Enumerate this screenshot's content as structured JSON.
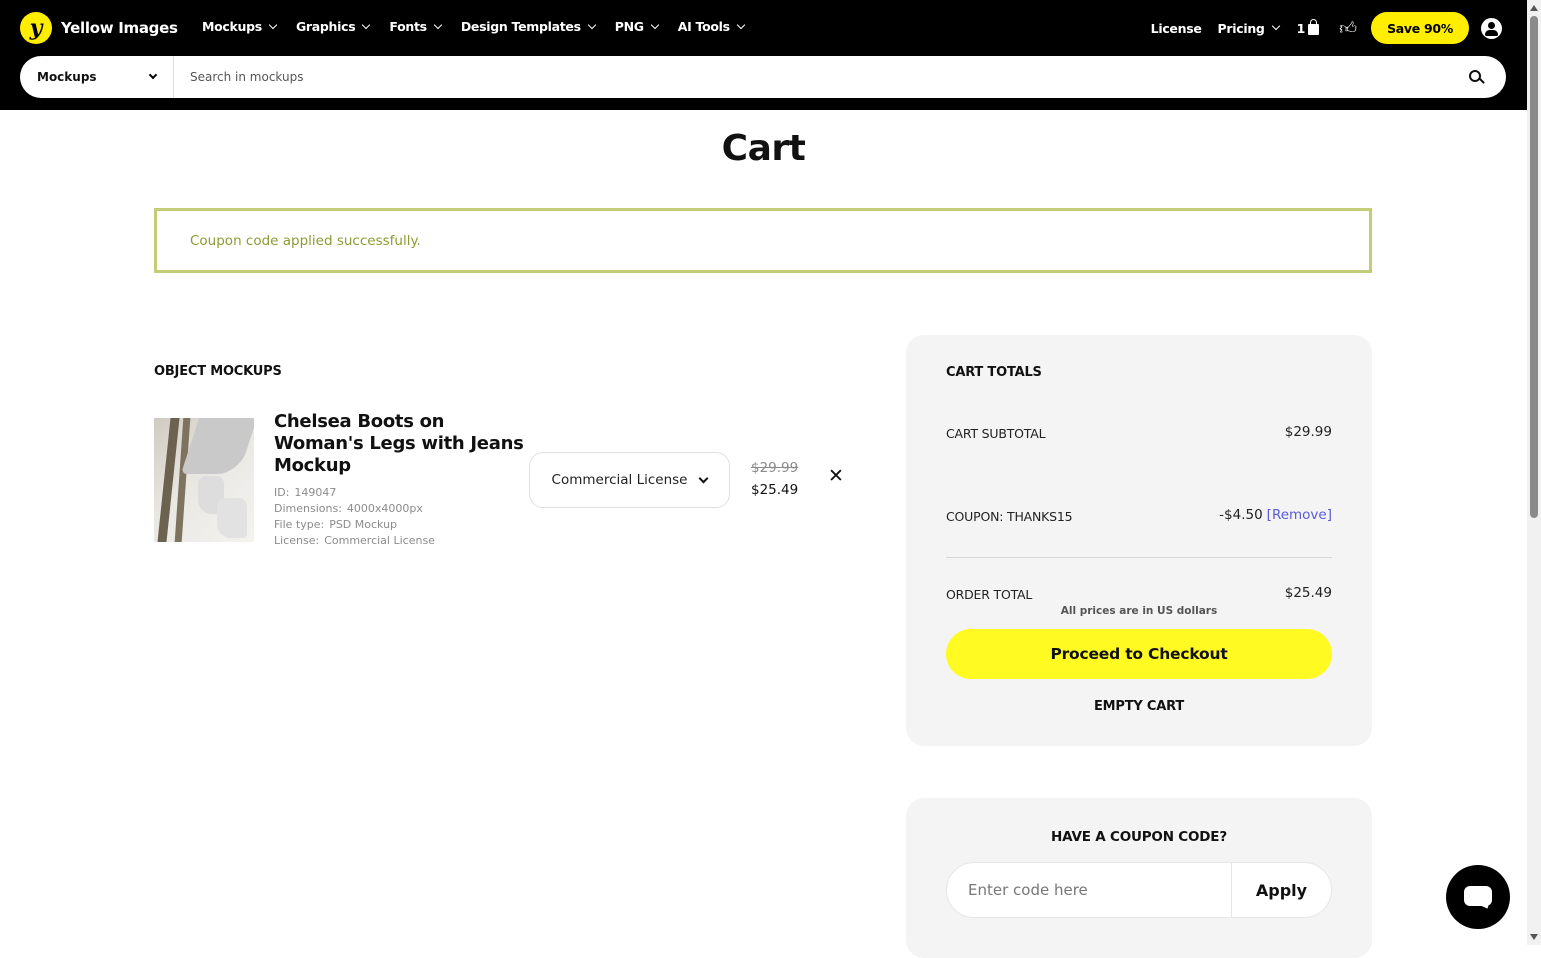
{
  "header": {
    "logo_text": "Yellow Images",
    "nav": [
      {
        "label": "Mockups"
      },
      {
        "label": "Graphics"
      },
      {
        "label": "Fonts"
      },
      {
        "label": "Design Templates"
      },
      {
        "label": "PNG"
      },
      {
        "label": "AI Tools"
      }
    ],
    "license_label": "License",
    "pricing_label": "Pricing",
    "cart_count": "1",
    "save_label": "Save 90%"
  },
  "search": {
    "category": "Mockups",
    "placeholder": "Search in mockups"
  },
  "page": {
    "title": "Cart",
    "notice": "Coupon code applied successfully."
  },
  "cart": {
    "section_label": "OBJECT MOCKUPS",
    "item": {
      "title": "Chelsea Boots on Woman's Legs with Jeans Mockup",
      "id_label": "ID:",
      "id": "149047",
      "dimensions_label": "Dimensions:",
      "dimensions": "4000x4000px",
      "filetype_label": "File type:",
      "filetype": "PSD Mockup",
      "license_label": "License:",
      "license": "Commercial License",
      "license_select": "Commercial License",
      "price_old": "$29.99",
      "price_new": "$25.49"
    }
  },
  "totals": {
    "heading": "CART TOTALS",
    "subtotal_label": "CART SUBTOTAL",
    "subtotal": "$29.99",
    "coupon_label": "COUPON: THANKS15",
    "coupon_value": "-$4.50",
    "coupon_remove": "[Remove]",
    "order_total_label": "ORDER TOTAL",
    "order_total": "$25.49",
    "note": "All prices are in US dollars",
    "checkout_label": "Proceed to Checkout",
    "empty_label": "EMPTY CART"
  },
  "coupon": {
    "heading": "HAVE A COUPON CODE?",
    "placeholder": "Enter code here",
    "apply_label": "Apply"
  },
  "colors": {
    "accent": "#ffee00",
    "notice_border": "#c3cc76",
    "notice_text": "#8e9a32",
    "remove_link": "#5b5bd6"
  },
  "icons": [
    "logo-icon",
    "chevron-down-icon",
    "bag-icon",
    "thumbs-up-icon",
    "user-icon",
    "search-icon",
    "close-icon",
    "chat-icon"
  ]
}
